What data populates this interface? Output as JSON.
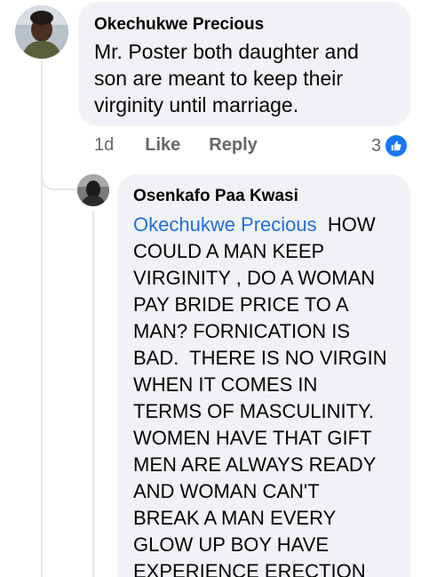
{
  "comments": [
    {
      "author": "Okechukwe Precious",
      "text": "Mr. Poster both daughter and son are meant to keep their virginity until marriage.",
      "time": "1d",
      "like_label": "Like",
      "reply_label": "Reply",
      "reaction_count": "3"
    },
    {
      "author": "Osenkafo Paa Kwasi",
      "mention": "Okechukwe Precious",
      "lines": [
        "  HOW",
        "COULD A MAN KEEP",
        "VIRGINITY , DO A WOMAN",
        "PAY BRIDE PRICE TO A",
        "MAN? FORNICATION IS",
        "BAD.  THERE IS NO VIRGIN",
        "WHEN IT COMES IN",
        "TERMS OF MASCULINITY.",
        "WOMEN HAVE THAT GIFT",
        "MEN ARE ALWAYS READY",
        "AND WOMAN CAN'T",
        "BREAK A MAN EVERY",
        "GLOW UP BOY HAVE",
        "EXPERIENCE ERECTION"
      ]
    }
  ],
  "icons": {
    "like_badge": "thumbs-up-icon"
  },
  "colors": {
    "mention": "#216fdb",
    "bubble": "#f0f2f5",
    "like_badge": "#1877f2",
    "meta": "#65676b"
  }
}
